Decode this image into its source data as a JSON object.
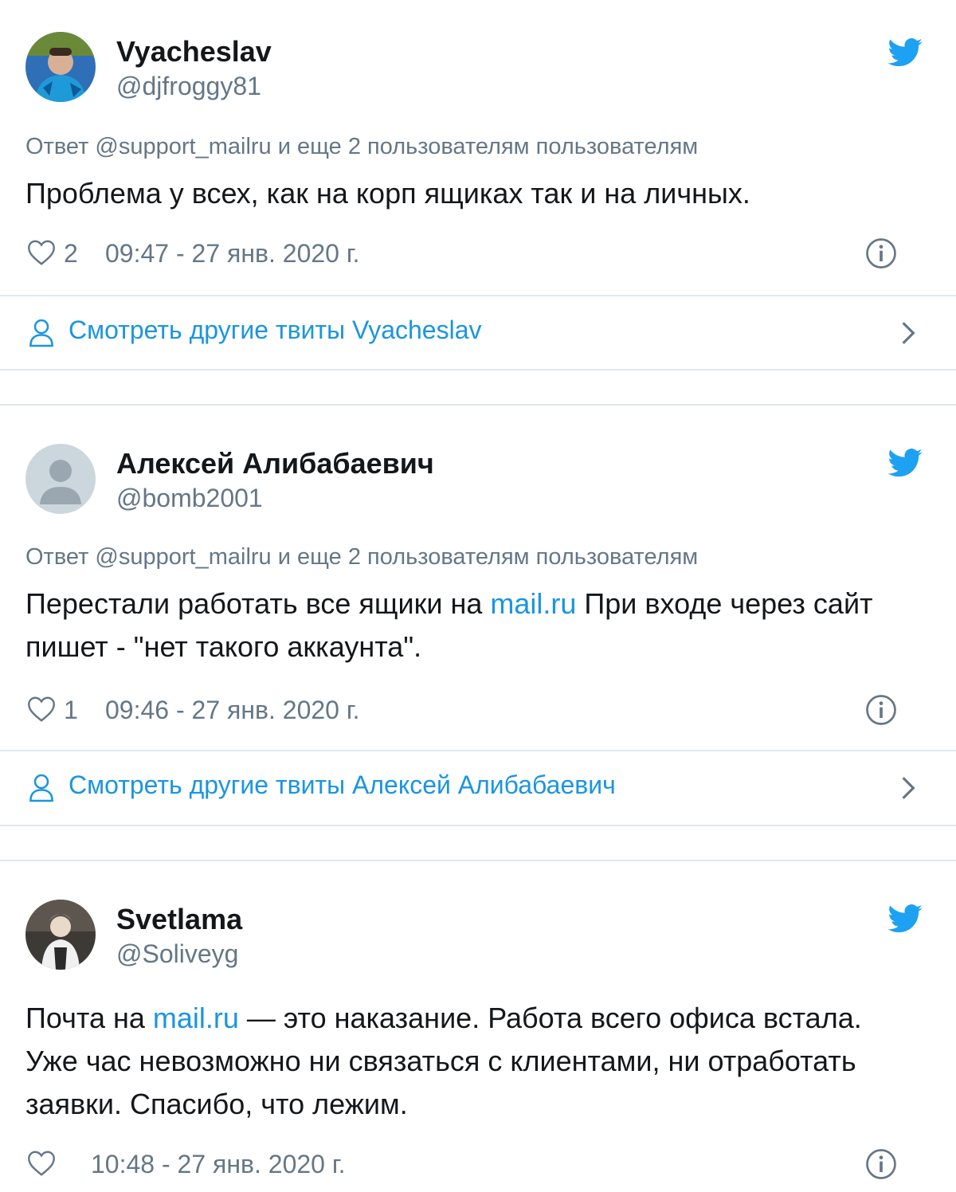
{
  "tweets": [
    {
      "name": "Vyacheslav",
      "handle": "@djfroggy81",
      "reply": "Ответ @support_mailru и еще 2 пользователям пользователям",
      "text": [
        {
          "t": "Проблема у всех, как на корп ящиках так и на личных."
        }
      ],
      "likes": "2",
      "time": "09:47 - 27 янв. 2020 г.",
      "more": "Смотреть другие твиты Vyacheslav",
      "avatar_icon": "photo-avatar"
    },
    {
      "name": "Алексей Алибабаевич",
      "handle": "@bomb2001",
      "reply": "Ответ @support_mailru и еще 2 пользователям пользователям",
      "text": [
        {
          "t": "Перестали работать все ящики на "
        },
        {
          "t": "mail.ru",
          "link": true
        },
        {
          "t": " При входе через сайт пишет - \"нет такого аккаунта\"."
        }
      ],
      "likes": "1",
      "time": "09:46 - 27 янв. 2020 г.",
      "more": "Смотреть другие твиты Алексей Алибабаевич",
      "avatar_icon": "default-avatar"
    },
    {
      "name": "Svetlama",
      "handle": "@Soliveyg",
      "reply": "",
      "text": [
        {
          "t": "Почта на "
        },
        {
          "t": "mail.ru",
          "link": true
        },
        {
          "t": " — это наказание. Работа всего офиса встала. Уже час невозможно ни связаться с клиентами, ни отработать заявки. Спасибо, что лежим."
        }
      ],
      "likes": "",
      "time": "10:48 - 27 янв. 2020 г.",
      "more": "",
      "avatar_icon": "photo-avatar"
    }
  ],
  "colors": {
    "brand": "#1da1f2",
    "link": "#1b95e0",
    "secondary_text": "#657786",
    "border": "#e1e8ed"
  }
}
